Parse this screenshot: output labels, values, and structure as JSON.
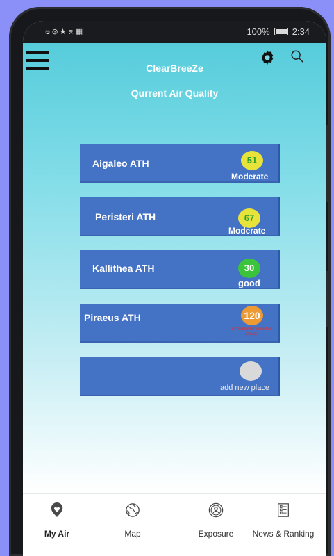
{
  "status_bar": {
    "left_icons": "ෂ⊙★⌆▦",
    "battery_percent": "100%",
    "time": "2:34"
  },
  "header": {
    "app_title": "ClearBreeZe",
    "subtitle": "Qurrent Air Quality"
  },
  "places": [
    {
      "name": "Aigaleo ATH",
      "aqi": "51",
      "status": "Moderate",
      "badge_color": "#e8e33a",
      "badge_text_color": "#2e9e2e"
    },
    {
      "name": "Peristeri ATH",
      "aqi": "67",
      "status": "Moderate",
      "badge_color": "#e8e33a",
      "badge_text_color": "#2e9e2e"
    },
    {
      "name": "Kallithea ATH",
      "aqi": "30",
      "status": "good",
      "badge_color": "#3bc43b",
      "badge_text_color": "#ffffff"
    },
    {
      "name": "Piraeus ATH",
      "aqi": "120",
      "status": "unhealthy for sensitive groups",
      "badge_color": "#ee9a34",
      "badge_text_color": "#ffffff"
    }
  ],
  "add_place": {
    "label": "add new place"
  },
  "bottom_nav": [
    {
      "label": "My Air",
      "icon": "heart-pin-icon",
      "active": true
    },
    {
      "label": "Map",
      "icon": "globe-icon",
      "active": false
    },
    {
      "label": "Exposure",
      "icon": "person-circle-icon",
      "active": false
    },
    {
      "label": "News & Ranking",
      "icon": "news-icon",
      "active": false
    }
  ],
  "colors": {
    "card": "#4472c4",
    "gradient_top": "#56ccdb",
    "background": "#8a90f7"
  }
}
